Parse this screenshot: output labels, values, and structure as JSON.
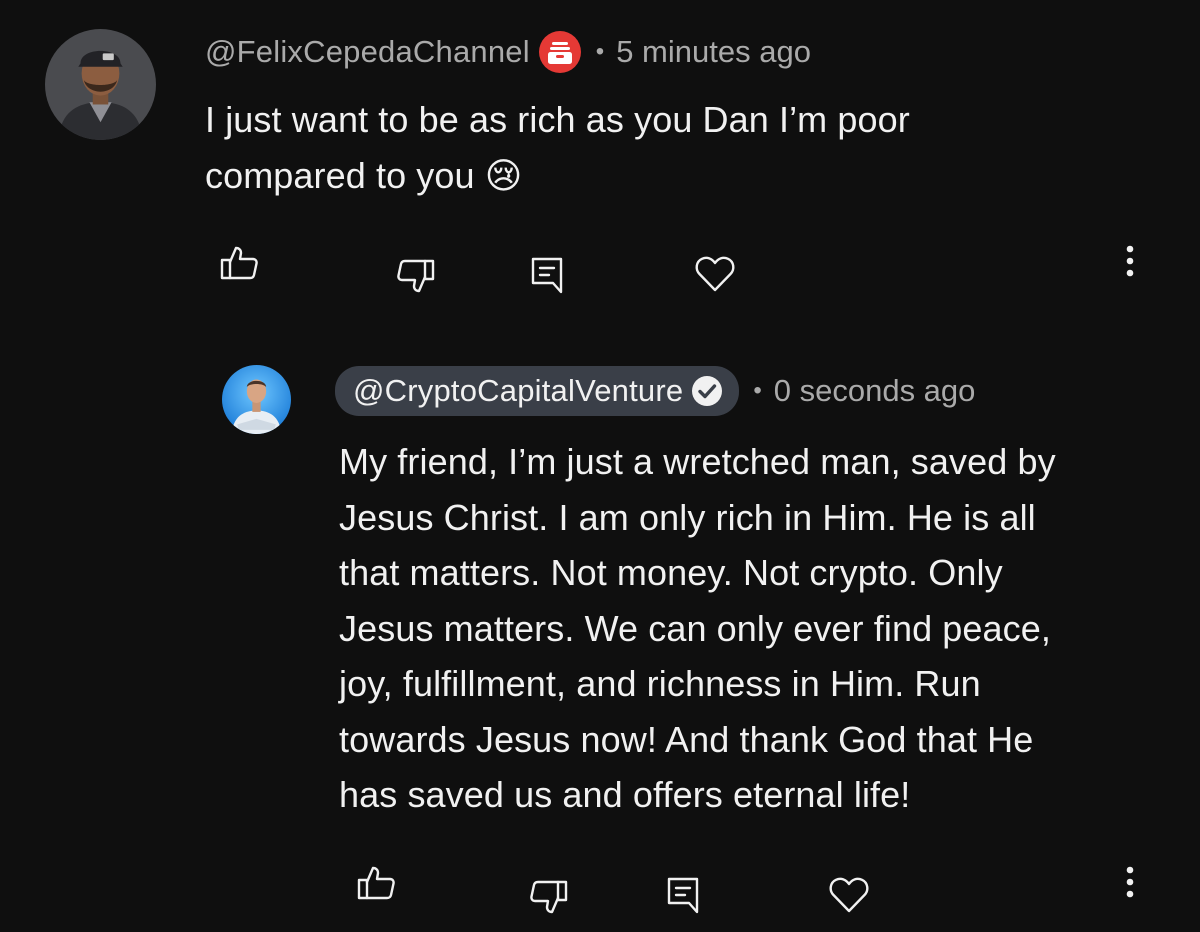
{
  "comment": {
    "author": "@FelixCepedaChannel",
    "badge_icon": "membership-badge-icon",
    "separator": "•",
    "timestamp": "5 minutes ago",
    "text_line1": "I just want to be as rich as you Dan I’m poor",
    "text_line2": "compared to you",
    "emoji": "😢",
    "actions": [
      "like-icon",
      "dislike-icon",
      "reply-icon",
      "heart-icon",
      "more-vert-icon"
    ]
  },
  "reply": {
    "author": "@CryptoCapitalVenture",
    "badge_icon": "verified-check-icon",
    "separator": "•",
    "timestamp": "0 seconds ago",
    "lines": [
      "My friend, I’m just a wretched man, saved by",
      "Jesus Christ. I am only rich in Him. He is all",
      "that matters. Not money. Not crypto. Only",
      "Jesus matters. We can only ever find peace,",
      "joy, fulfillment, and richness in Him. Run",
      "towards Jesus now! And thank God that He",
      "has saved us and offers eternal life!"
    ],
    "actions": [
      "like-icon",
      "dislike-icon",
      "reply-icon",
      "heart-icon",
      "more-vert-icon"
    ]
  },
  "colors": {
    "background": "#0f0f0f",
    "text": "#f1f1f1",
    "secondary_text": "#aaaaaa",
    "creator_pill": "#3a3f48",
    "membership_badge": "#e53935"
  }
}
